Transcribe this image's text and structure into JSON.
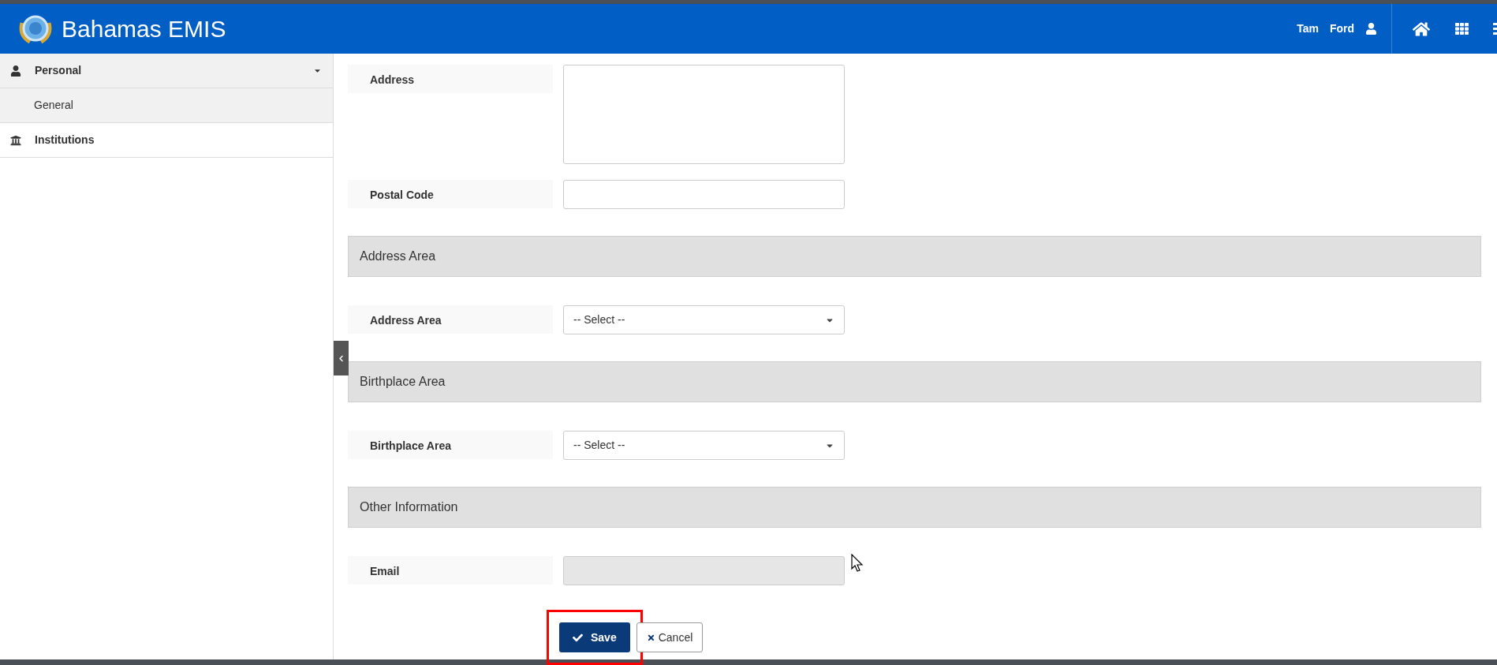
{
  "header": {
    "title": "Bahamas EMIS",
    "user_name": "Tam Ford"
  },
  "sidebar": {
    "items": [
      {
        "label": "Personal",
        "kind": "user",
        "expanded": true,
        "children": [
          {
            "label": "General",
            "selected": true
          }
        ]
      },
      {
        "label": "Institutions",
        "kind": "bank",
        "expanded": false
      }
    ]
  },
  "form": [
    {
      "kind": "textarea",
      "label": "Address"
    },
    {
      "kind": "text",
      "label": "Postal Code",
      "disabled": false
    },
    {
      "kind": "section",
      "label": "Address Area"
    },
    {
      "kind": "select",
      "label": "Address Area",
      "value": "-- Select --"
    },
    {
      "kind": "section",
      "label": "Birthplace Area"
    },
    {
      "kind": "select",
      "label": "Birthplace Area",
      "value": "-- Select --"
    },
    {
      "kind": "section",
      "label": "Other Information"
    },
    {
      "kind": "text",
      "label": "Email",
      "disabled": true
    }
  ],
  "buttons": {
    "save": "Save",
    "cancel": "Cancel",
    "save_highlighted": true
  }
}
